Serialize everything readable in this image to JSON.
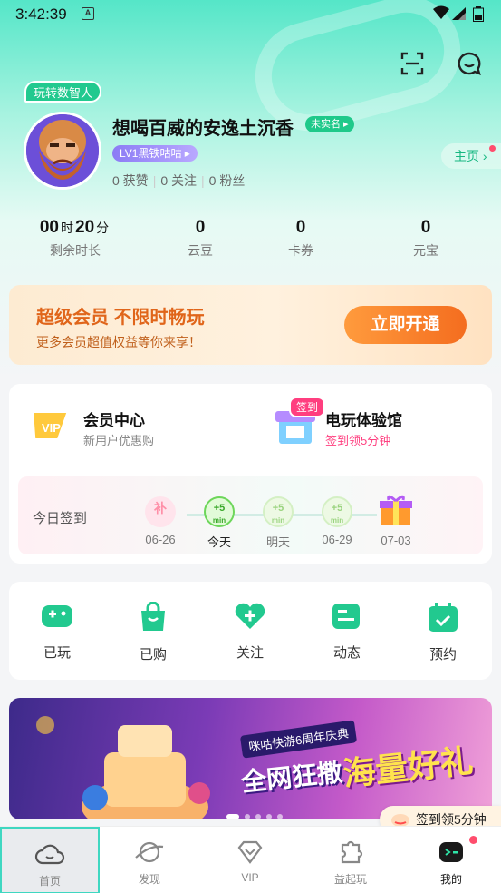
{
  "status_bar": {
    "time": "3:42:39",
    "app_icon_letter": "A"
  },
  "top_actions": {
    "scan_icon": "scan-icon",
    "message_icon": "chat-bubble-icon"
  },
  "profile": {
    "badge": "玩转数智人",
    "name": "想喝百威的安逸土沉香",
    "verify": "未实名",
    "level": "LV1黑铁咕咕",
    "likes": "0 获赞",
    "following": "0 关注",
    "followers": "0 粉丝",
    "home_button": "主页"
  },
  "stats": [
    {
      "value_h": "00",
      "unit_h": "时",
      "value_m": "20",
      "unit_m": "分",
      "label": "剩余时长"
    },
    {
      "value": "0",
      "label": "云豆"
    },
    {
      "value": "0",
      "label": "卡券"
    },
    {
      "value": "0",
      "label": "元宝"
    }
  ],
  "vip_banner": {
    "title": "超级会员 不限时畅玩",
    "subtitle": "更多会员超值权益等你来享！",
    "button": "立即开通"
  },
  "member": {
    "vip_center_title": "会员中心",
    "vip_center_sub": "新用户优惠购",
    "vip_badge": "VIP",
    "arcade_tag": "签到",
    "arcade_title": "电玩体验馆",
    "arcade_sub": "签到领5分钟",
    "checkin_label": "今日签到",
    "days": [
      {
        "mark": "补",
        "date": "06-26"
      },
      {
        "mark": "+5",
        "unit": "min",
        "date": "今天"
      },
      {
        "mark": "+5",
        "unit": "min",
        "date": "明天"
      },
      {
        "mark": "+5",
        "unit": "min",
        "date": "06-29"
      },
      {
        "mark": "",
        "date": "07-03"
      }
    ]
  },
  "functions": [
    {
      "label": "已玩",
      "icon": "gamepad-icon"
    },
    {
      "label": "已购",
      "icon": "shopping-bag-icon"
    },
    {
      "label": "关注",
      "icon": "heart-plus-icon"
    },
    {
      "label": "动态",
      "icon": "feed-icon"
    },
    {
      "label": "预约",
      "icon": "calendar-check-icon"
    }
  ],
  "promo_banner": {
    "subtitle": "咪咕快游6周年庆典",
    "headline_1": "全网狂撒",
    "headline_2": "海量好礼"
  },
  "float_badge": "签到领5分钟",
  "tabbar": [
    {
      "label": "首页",
      "icon": "cloud-icon",
      "active": true
    },
    {
      "label": "发现",
      "icon": "planet-icon"
    },
    {
      "label": "VIP",
      "icon": "diamond-icon"
    },
    {
      "label": "益起玩",
      "icon": "puzzle-icon"
    },
    {
      "label": "我的",
      "icon": "mine-face-icon"
    }
  ],
  "colors": {
    "accent": "#22c98f",
    "vip_orange": "#f46d1f",
    "badge_red": "#ff4d6d"
  }
}
